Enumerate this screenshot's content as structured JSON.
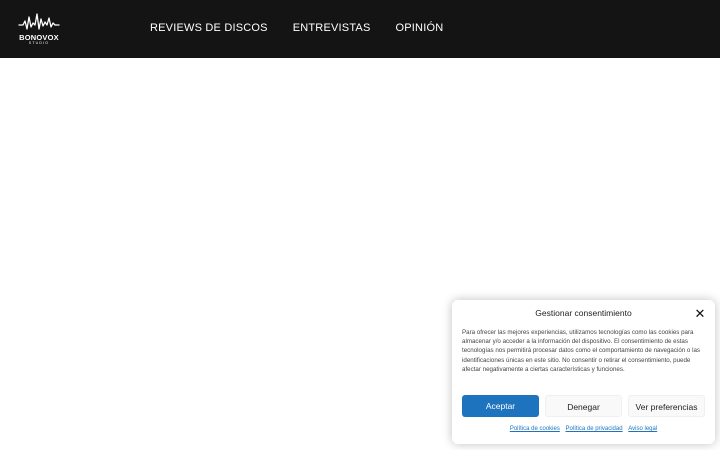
{
  "header": {
    "logo": {
      "name": "BONOVOX",
      "sub": "STUDIO",
      "icon": "waveform-icon"
    },
    "background": "#141414",
    "nav": [
      {
        "label": "REVIEWS DE DISCOS"
      },
      {
        "label": "ENTREVISTAS"
      },
      {
        "label": "OPINIÓN"
      }
    ]
  },
  "consent": {
    "title": "Gestionar consentimiento",
    "close_icon": "close-icon",
    "text": "Para ofrecer las mejores experiencias, utilizamos tecnologías como las cookies para almacenar y/o acceder a la información del dispositivo. El consentimiento de estas tecnologías nos permitirá procesar datos como el comportamiento de navegación o las identificaciones únicas en este sitio. No consentir o retirar el consentimiento, puede afectar negativamente a ciertas características y funciones.",
    "buttons": {
      "accept": "Aceptar",
      "deny": "Denegar",
      "preferences": "Ver preferencias"
    },
    "links": {
      "cookies": "Política de cookies",
      "privacy": "Política de privacidad",
      "legal": "Aviso legal"
    },
    "accent_color": "#1e73be"
  }
}
